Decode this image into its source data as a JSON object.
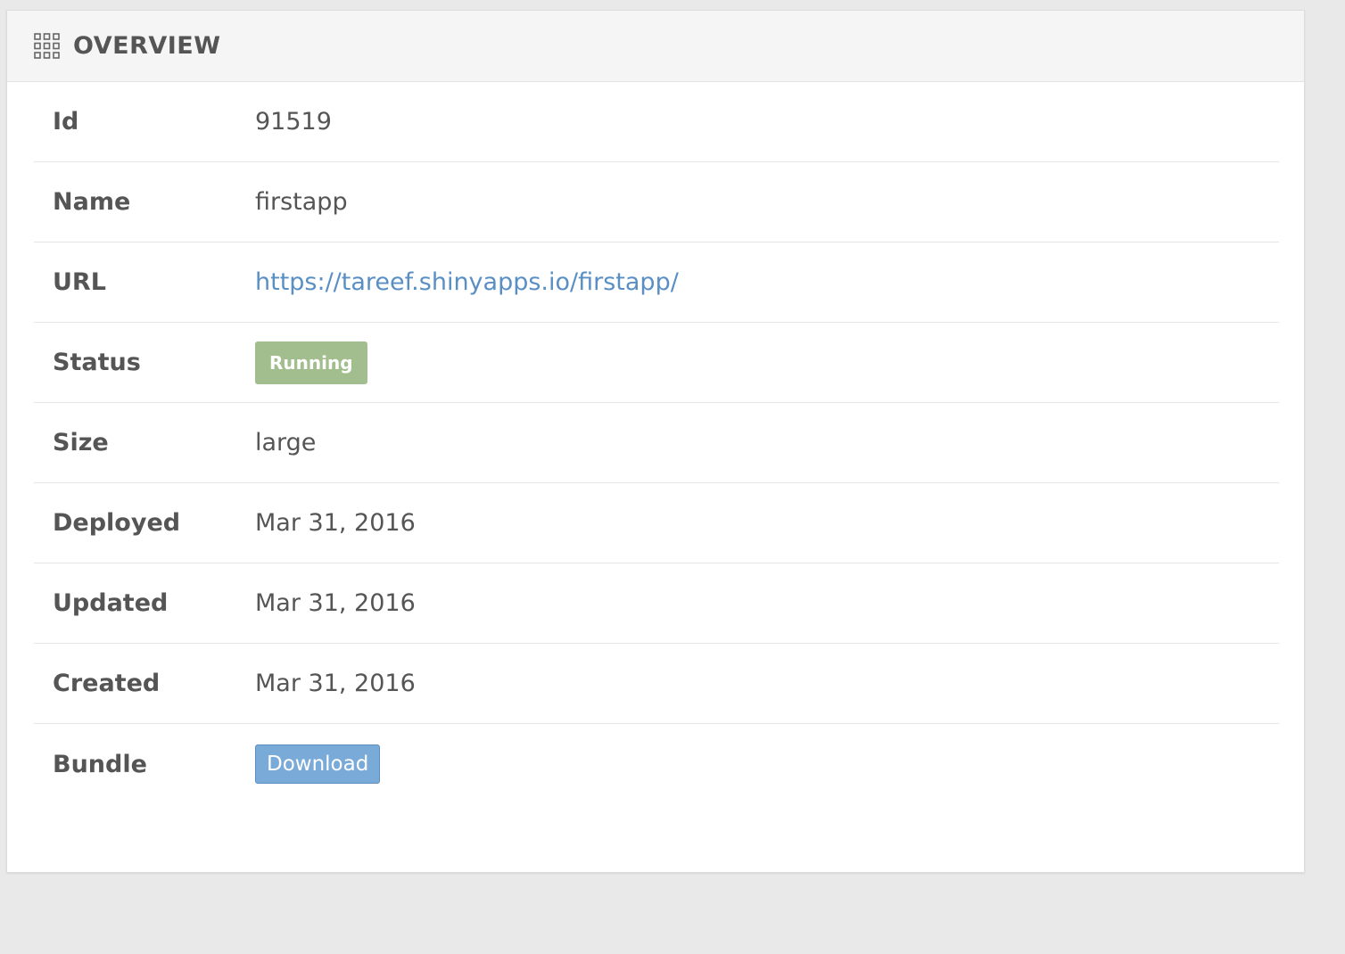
{
  "panel": {
    "title": "OVERVIEW",
    "icon": "grid-icon"
  },
  "rows": [
    {
      "label": "Id",
      "value": "91519"
    },
    {
      "label": "Name",
      "value": "firstapp"
    },
    {
      "label": "URL",
      "value": "https://tareef.shinyapps.io/firstapp/"
    },
    {
      "label": "Status",
      "value": "Running"
    },
    {
      "label": "Size",
      "value": "large"
    },
    {
      "label": "Deployed",
      "value": "Mar 31, 2016"
    },
    {
      "label": "Updated",
      "value": "Mar 31, 2016"
    },
    {
      "label": "Created",
      "value": "Mar 31, 2016"
    },
    {
      "label": "Bundle",
      "value": "Download"
    }
  ],
  "colors": {
    "status_badge": "#a2bd8e",
    "link": "#5a8fc4",
    "button": "#7aaad7"
  }
}
